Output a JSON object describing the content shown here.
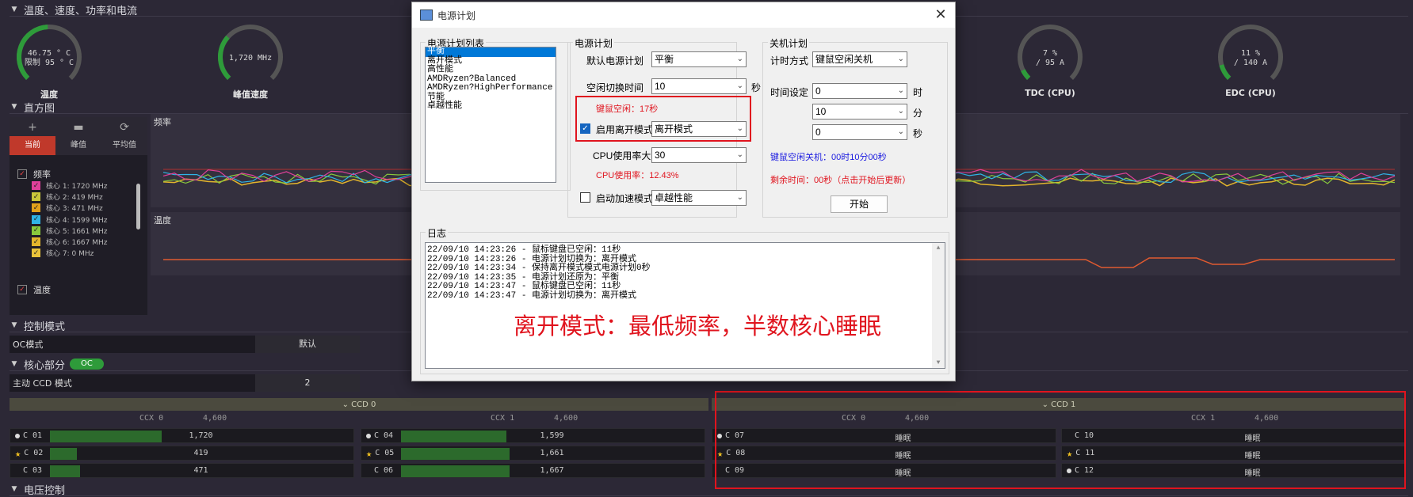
{
  "sections": {
    "temp": "温度、速度、功率和电流",
    "histogram": "直方图",
    "control": "控制模式",
    "core": "核心部分",
    "voltage": "电压控制"
  },
  "gauges": [
    {
      "line1": "46.75 ° C",
      "line2": "限制 95 ° C",
      "label": "温度",
      "fraction": 0.49
    },
    {
      "line1": "1,720  MHz",
      "line2": "",
      "label": "峰值速度",
      "fraction": 0.32
    },
    {
      "line1": "7 %",
      "line2": "/ 95 A",
      "label": "TDC (CPU)",
      "fraction": 0.07
    },
    {
      "line1": "11 %",
      "line2": "/ 140 A",
      "label": "EDC (CPU)",
      "fraction": 0.11
    }
  ],
  "histogram_panel": {
    "tabs": [
      "当前",
      "峰值",
      "平均值"
    ],
    "freq_label": "频率",
    "temp_label": "温度",
    "cores": [
      {
        "label": "核心 1: 1720 MHz",
        "color": "#e0409a"
      },
      {
        "label": "核心 2: 419 MHz",
        "color": "#c9c73a"
      },
      {
        "label": "核心 3: 471 MHz",
        "color": "#e2a21b"
      },
      {
        "label": "核心 4: 1599 MHz",
        "color": "#2fb4e6"
      },
      {
        "label": "核心 5: 1661 MHz",
        "color": "#89c93c"
      },
      {
        "label": "核心 6: 1667 MHz",
        "color": "#e3b52c"
      },
      {
        "label": "核心 7: 0 MHz",
        "color": "#e8c23a"
      }
    ],
    "graph_freq_title": "频率",
    "graph_temp_title": "温度"
  },
  "control": {
    "oc_label": "OC模式",
    "oc_value": "默认",
    "badge": "OC",
    "ccd_label": "主动 CCD 模式",
    "ccd_value": "2"
  },
  "ccd": [
    {
      "title": "CCD 0",
      "ccx": [
        {
          "title": "CCX 0",
          "freq": "4,600",
          "cores": [
            {
              "name": "C 01",
              "mark": "dot",
              "value": "1,720",
              "fill": 0.37
            },
            {
              "name": "C 02",
              "mark": "star",
              "value": "419",
              "fill": 0.09
            },
            {
              "name": "C 03",
              "mark": "",
              "value": "471",
              "fill": 0.1
            }
          ]
        },
        {
          "title": "CCX 1",
          "freq": "4,600",
          "cores": [
            {
              "name": "C 04",
              "mark": "dot",
              "value": "1,599",
              "fill": 0.35
            },
            {
              "name": "C 05",
              "mark": "star",
              "value": "1,661",
              "fill": 0.36
            },
            {
              "name": "C 06",
              "mark": "",
              "value": "1,667",
              "fill": 0.36
            }
          ]
        }
      ]
    },
    {
      "title": "CCD 1",
      "ccx": [
        {
          "title": "CCX 0",
          "freq": "4,600",
          "cores": [
            {
              "name": "C 07",
              "mark": "dot",
              "value": "睡眠",
              "fill": 0
            },
            {
              "name": "C 08",
              "mark": "star",
              "value": "睡眠",
              "fill": 0
            },
            {
              "name": "C 09",
              "mark": "",
              "value": "睡眠",
              "fill": 0
            }
          ]
        },
        {
          "title": "CCX 1",
          "freq": "4,600",
          "cores": [
            {
              "name": "C 10",
              "mark": "",
              "value": "睡眠",
              "fill": 0
            },
            {
              "name": "C 11",
              "mark": "star",
              "value": "睡眠",
              "fill": 0
            },
            {
              "name": "C 12",
              "mark": "dot",
              "value": "睡眠",
              "fill": 0
            }
          ]
        }
      ]
    }
  ],
  "dialog": {
    "title": "电源计划",
    "list_group": "电源计划列表",
    "plans": [
      "平衡",
      "离开模式",
      "高性能",
      "AMDRyzen?Balanced",
      "AMDRyzen?HighPerformance",
      "节能",
      "卓越性能"
    ],
    "plan_group": "电源计划",
    "default_plan_label": "默认电源计划",
    "default_plan_value": "平衡",
    "idle_switch_label": "空闲切换时间",
    "idle_switch_value": "10",
    "sec": "秒",
    "kb_idle": "键鼠空闲：17秒",
    "enable_away_label": "启用离开模式",
    "away_value": "离开模式",
    "cpu_usage_label": "CPU使用率大于",
    "cpu_usage_value": "30",
    "cpu_usage_now": "CPU使用率：12.43%",
    "boost_label": "启动加速模式",
    "boost_value": "卓越性能",
    "shutdown_group": "关机计划",
    "timer_label": "计时方式",
    "timer_value": "键鼠空闲关机",
    "time_set_label": "时间设定",
    "hour_value": "0",
    "hour_unit": "时",
    "min_value": "10",
    "min_unit": "分",
    "sec_value": "0",
    "sec_unit": "秒",
    "shutdown_info": "键鼠空闲关机：00时10分00秒",
    "remain_info": "剩余时间：00秒（点击开始后更新）",
    "start_btn": "开始",
    "log_group": "日志",
    "log": [
      "22/09/10 14:23:26 - 鼠标键盘已空闲：11秒",
      "22/09/10 14:23:26 - 电源计划切换为：离开模式",
      "22/09/10 14:23:34 - 保持离开模式模式电源计划0秒",
      "22/09/10 14:23:35 - 电源计划还原为：平衡",
      "22/09/10 14:23:47 - 鼠标键盘已空闲：11秒",
      "22/09/10 14:23:47 - 电源计划切换为：离开模式"
    ],
    "annotation": "离开模式：最低频率，半数核心睡眠"
  }
}
